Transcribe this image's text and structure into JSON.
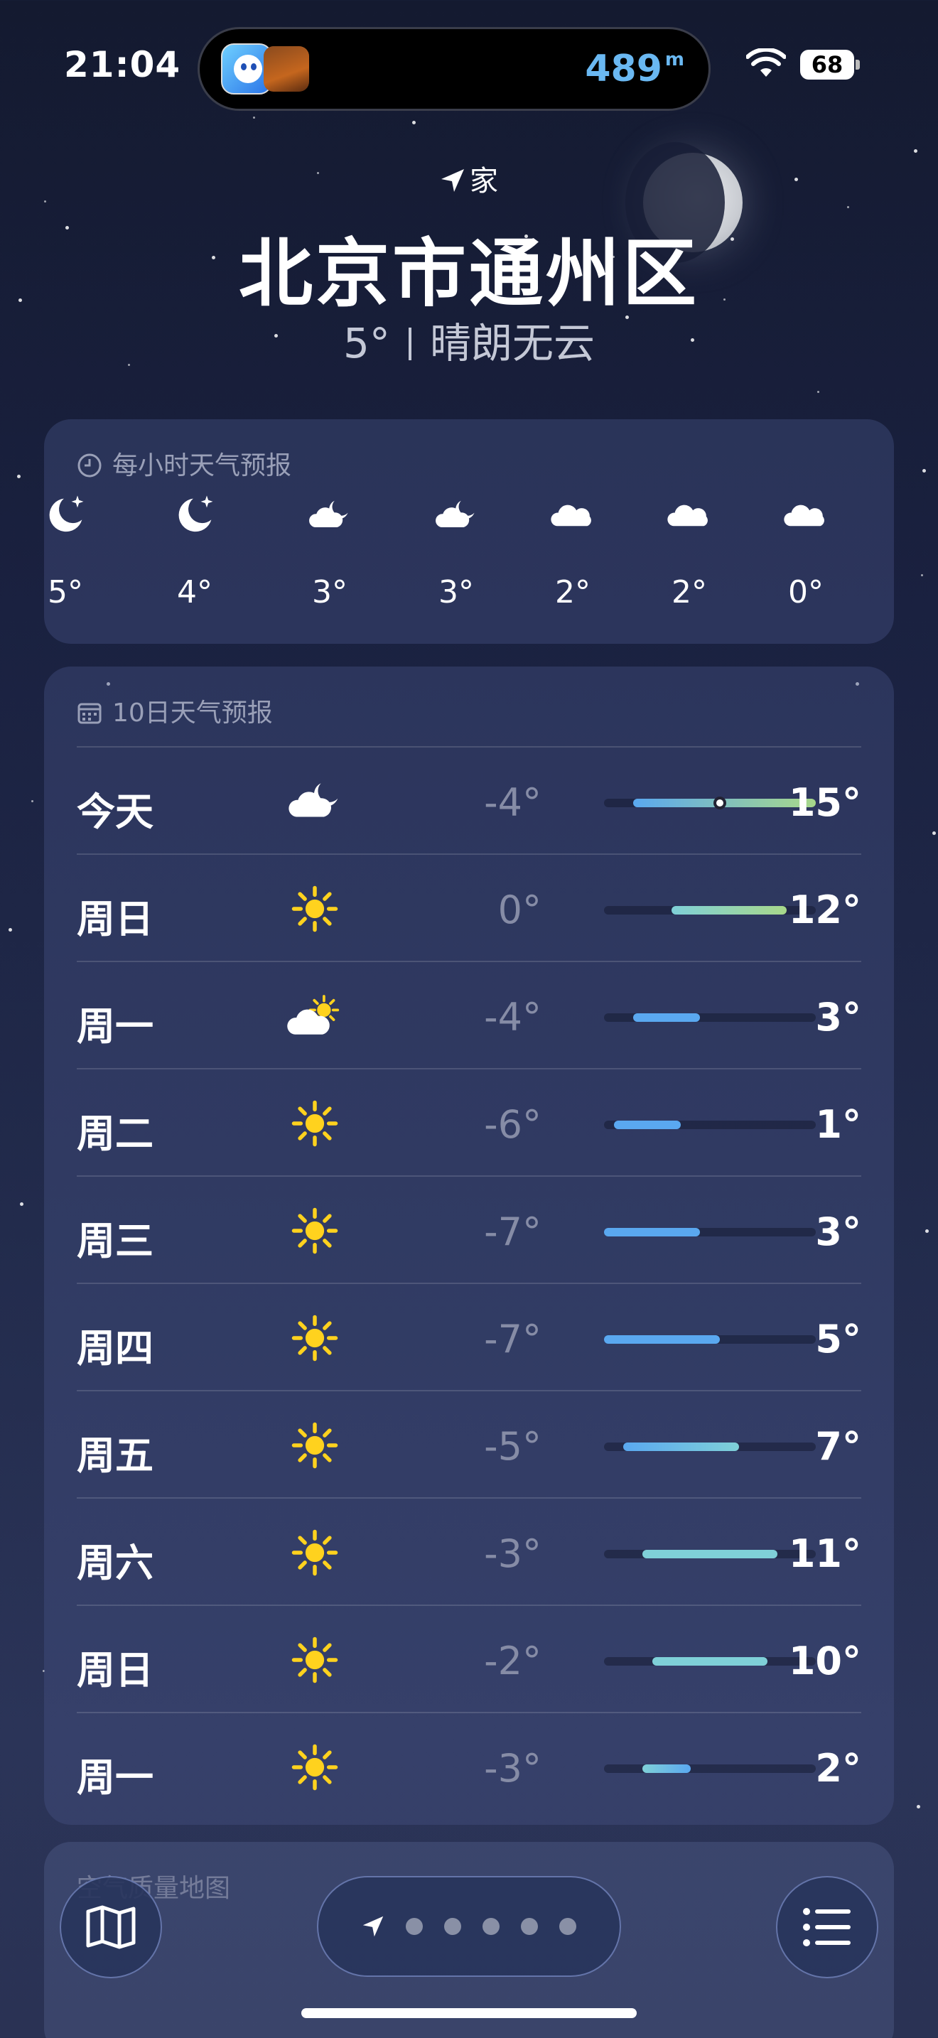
{
  "status_bar": {
    "time": "21:04",
    "distance": "489",
    "distance_unit": "m",
    "battery": "68"
  },
  "location": {
    "label": "家",
    "city": "北京市通州区",
    "temperature": "5°",
    "condition": "晴朗无云"
  },
  "hourly": {
    "title": "每小时天气预报",
    "items": [
      {
        "icon": "moon-star-icon",
        "temp": "5°"
      },
      {
        "icon": "moon-star-icon",
        "temp": "4°"
      },
      {
        "icon": "cloud-moon-icon",
        "temp": "3°"
      },
      {
        "icon": "cloud-moon-icon",
        "temp": "3°"
      },
      {
        "icon": "cloud-icon",
        "temp": "2°"
      },
      {
        "icon": "cloud-icon",
        "temp": "2°"
      },
      {
        "icon": "cloud-icon",
        "temp": "0°"
      }
    ]
  },
  "daily": {
    "title": "10日天气预报",
    "range": {
      "min": -7,
      "max": 15
    },
    "days": [
      {
        "name": "今天",
        "icon": "cloud-moon-icon",
        "low": "-4°",
        "high": "15°",
        "low_val": -4,
        "high_val": 15,
        "current": 5
      },
      {
        "name": "周日",
        "icon": "sun-icon",
        "low": "0°",
        "high": "12°",
        "low_val": 0,
        "high_val": 12
      },
      {
        "name": "周一",
        "icon": "cloud-sun-icon",
        "low": "-4°",
        "high": "3°",
        "low_val": -4,
        "high_val": 3
      },
      {
        "name": "周二",
        "icon": "sun-icon",
        "low": "-6°",
        "high": "1°",
        "low_val": -6,
        "high_val": 1
      },
      {
        "name": "周三",
        "icon": "sun-icon",
        "low": "-7°",
        "high": "3°",
        "low_val": -7,
        "high_val": 3
      },
      {
        "name": "周四",
        "icon": "sun-icon",
        "low": "-7°",
        "high": "5°",
        "low_val": -7,
        "high_val": 5
      },
      {
        "name": "周五",
        "icon": "sun-icon",
        "low": "-5°",
        "high": "7°",
        "low_val": -5,
        "high_val": 7
      },
      {
        "name": "周六",
        "icon": "sun-icon",
        "low": "-3°",
        "high": "11°",
        "low_val": -3,
        "high_val": 11
      },
      {
        "name": "周日",
        "icon": "sun-icon",
        "low": "-2°",
        "high": "10°",
        "low_val": -2,
        "high_val": 10
      },
      {
        "name": "周一",
        "icon": "sun-icon",
        "low": "-3°",
        "high": "2°",
        "low_val": -3,
        "high_val": 2
      }
    ]
  },
  "air_quality": {
    "title": "空气质量地图"
  },
  "colors": {
    "cold": "#5aa8f0",
    "cool": "#7fd0d8",
    "mild": "#a8d88a",
    "sun": "#ffd21e"
  }
}
